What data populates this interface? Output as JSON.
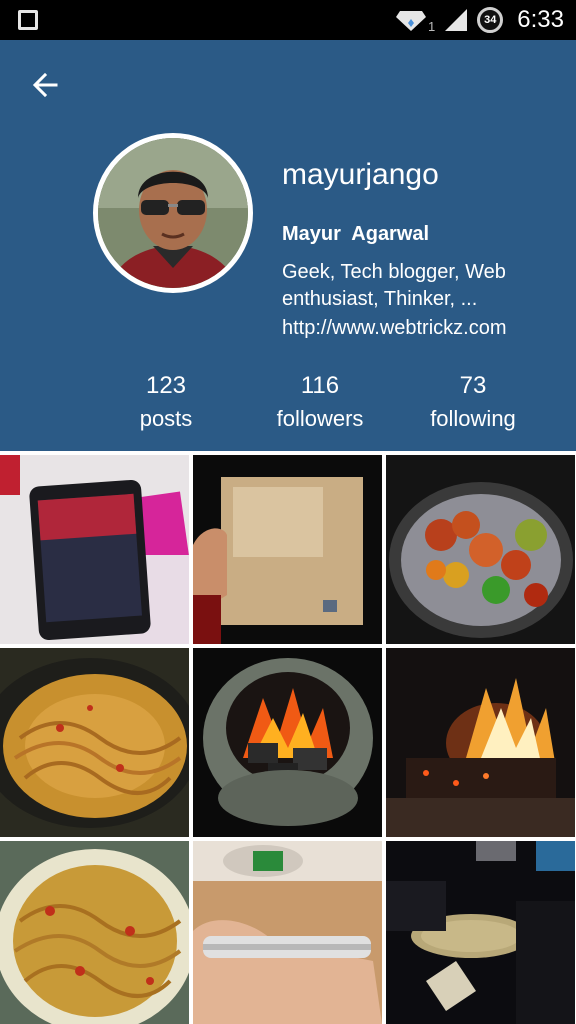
{
  "status_bar": {
    "sim_slot": "1",
    "battery": "34",
    "time": "6:33"
  },
  "profile": {
    "username": "mayurjango",
    "full_name": "Mayur  Agarwal",
    "bio": "Geek, Tech blogger, Web enthusiast, Thinker, ...",
    "website": "http://www.webtrickz.com"
  },
  "stats": [
    {
      "value": "123",
      "label": "posts"
    },
    {
      "value": "116",
      "label": "followers"
    },
    {
      "value": "73",
      "label": "following"
    }
  ],
  "colors": {
    "header_bg": "#2b5a86",
    "status_bar_bg": "#000000"
  },
  "icons": {
    "back": "arrow-left-icon",
    "notification": "square-icon",
    "data": "diamond-data-icon",
    "signal": "signal-icon",
    "battery": "battery-circle-icon"
  },
  "photos": [
    {
      "subject": "phone-on-desk"
    },
    {
      "subject": "cardboard-box"
    },
    {
      "subject": "tandoori-plate"
    },
    {
      "subject": "noodles-pan"
    },
    {
      "subject": "charcoal-stove"
    },
    {
      "subject": "bonfire"
    },
    {
      "subject": "noodles-plate"
    },
    {
      "subject": "phone-in-hand"
    },
    {
      "subject": "street-food-night"
    }
  ]
}
